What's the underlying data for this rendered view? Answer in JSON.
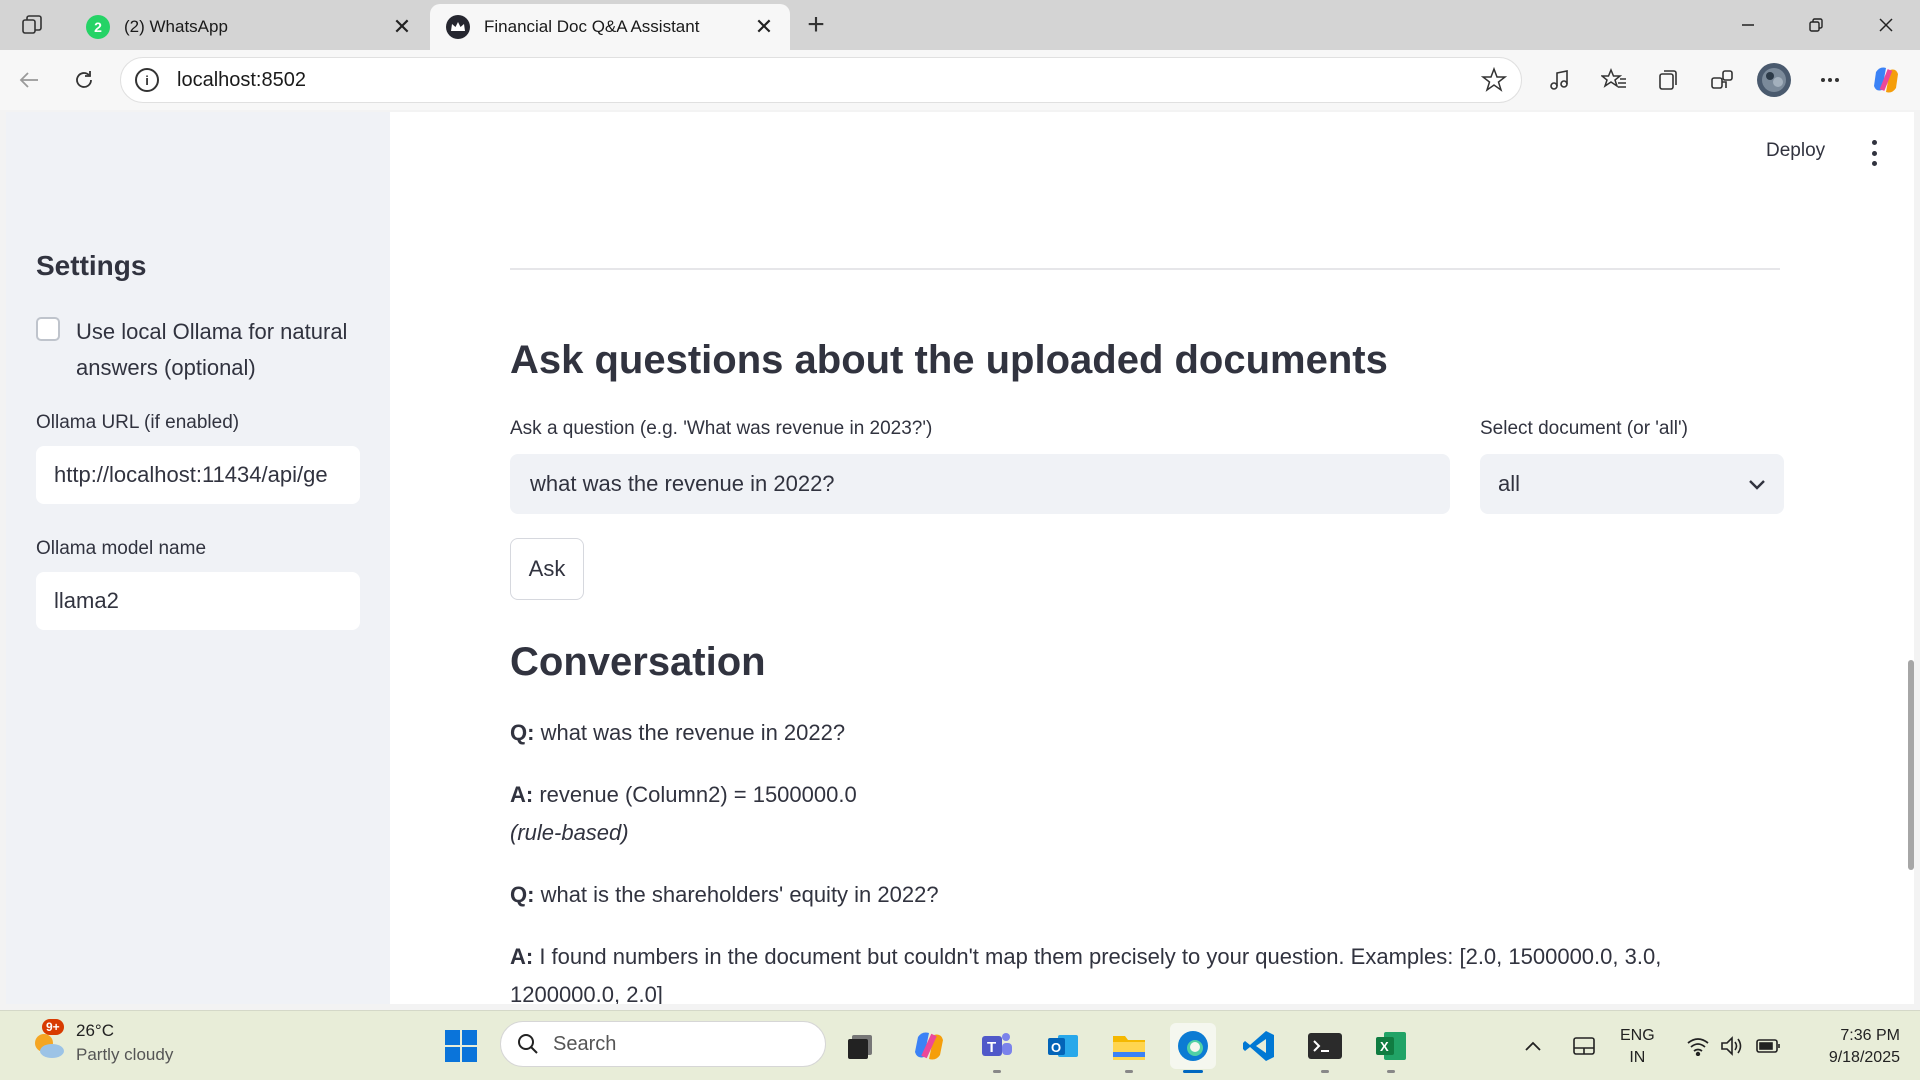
{
  "browser": {
    "tabs": [
      {
        "title": "(2) WhatsApp",
        "badge": "2",
        "favicon": "whatsapp-icon",
        "active": false
      },
      {
        "title": "Financial Doc Q&A Assistant",
        "favicon": "streamlit-crown-icon",
        "active": true
      }
    ],
    "url": "localhost:8502"
  },
  "app": {
    "deploy_label": "Deploy",
    "sidebar": {
      "title": "Settings",
      "checkbox_label": "Use local Ollama for natural answers (optional)",
      "checkbox_checked": false,
      "ollama_url_label": "Ollama URL (if enabled)",
      "ollama_url_value": "http://localhost:11434/api/ge",
      "model_label": "Ollama model name",
      "model_value": "llama2"
    },
    "main": {
      "heading": "Ask questions about the uploaded documents",
      "question_label": "Ask a question (e.g. 'What was revenue in 2023?')",
      "question_value": "what was the revenue in 2022?",
      "select_label": "Select document (or 'all')",
      "select_value": "all",
      "ask_button": "Ask",
      "conversation_heading": "Conversation",
      "conversation": [
        {
          "prefix": "Q:",
          "text": " what was the revenue in 2022?"
        },
        {
          "prefix": "A:",
          "text": " revenue (Column2) = 1500000.0",
          "note": "(rule-based)"
        },
        {
          "prefix": "Q:",
          "text": " what is the shareholders' equity in 2022?"
        },
        {
          "prefix": "A:",
          "text": " I found numbers in the document but couldn't map them precisely to your question. Examples: [2.0, 1500000.0, 3.0,",
          "continuation": "1200000.0, 2.0]"
        }
      ]
    }
  },
  "taskbar": {
    "weather_temp": "26°C",
    "weather_desc": "Partly cloudy",
    "weather_badge": "9+",
    "search_placeholder": "Search",
    "lang_line1": "ENG",
    "lang_line2": "IN",
    "time": "7:36 PM",
    "date": "9/18/2025"
  }
}
